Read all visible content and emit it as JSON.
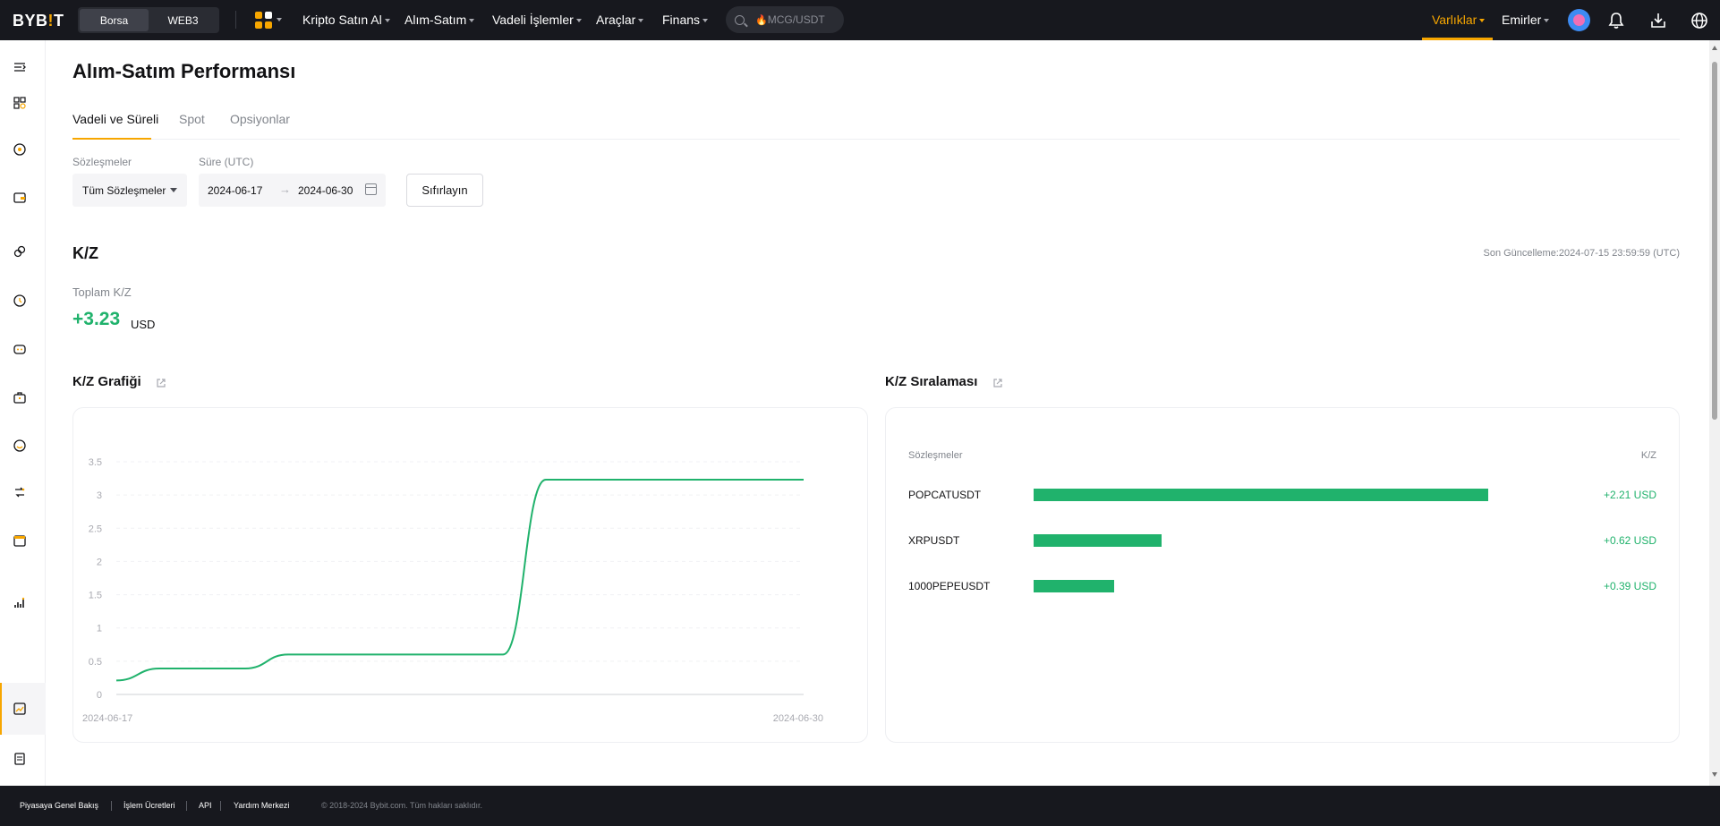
{
  "brand": {
    "logo_main": "BYB",
    "logo_i": "!",
    "logo_end": "T"
  },
  "top_nav": {
    "segment": {
      "left": "Borsa",
      "right": "WEB3",
      "active": "Borsa"
    },
    "menu": [
      {
        "label": "Kripto Satın Al"
      },
      {
        "label": "Alım-Satım"
      },
      {
        "label": "Vadeli İşlemler"
      },
      {
        "label": "Araçlar"
      },
      {
        "label": "Finans"
      }
    ],
    "search": {
      "placeholder": "MCG/USDT",
      "flame": "🔥"
    },
    "right": {
      "assets": "Varlıklar",
      "orders": "Emirler"
    }
  },
  "page": {
    "title": "Alım-Satım Performansı",
    "tabs": [
      {
        "label": "Vadeli ve Süreli",
        "active": true
      },
      {
        "label": "Spot",
        "active": false
      },
      {
        "label": "Opsiyonlar",
        "active": false
      }
    ],
    "filters": {
      "contracts_label": "Sözleşmeler",
      "contracts_value": "Tüm Sözleşmeler",
      "duration_label": "Süre (UTC)",
      "date_from": "2024-06-17",
      "date_arrow": "→",
      "date_to": "2024-06-30",
      "reset_label": "Sıfırlayın"
    },
    "pnl": {
      "title": "K/Z",
      "last_update": "Son Güncelleme:2024-07-15 23:59:59 (UTC)",
      "total_label": "Toplam K/Z",
      "total_value": "+3.23",
      "total_unit": "USD"
    },
    "chart_card": {
      "title": "K/Z Grafiği"
    },
    "ranking_card": {
      "title": "K/Z Sıralaması",
      "col_contract": "Sözleşmeler",
      "col_pnl": "K/Z",
      "rows": [
        {
          "symbol": "POPCATUSDT",
          "pnl": "+2.21 USD",
          "value": 2.21
        },
        {
          "symbol": "XRPUSDT",
          "pnl": "+0.62 USD",
          "value": 0.62
        },
        {
          "symbol": "1000PEPEUSDT",
          "pnl": "+0.39 USD",
          "value": 0.39
        }
      ]
    }
  },
  "chart_data": {
    "type": "line",
    "title": "K/Z Grafiği",
    "x_start_label": "2024-06-17",
    "x_end_label": "2024-06-30",
    "y_ticks": [
      "0",
      "0.5",
      "1",
      "1.5",
      "2",
      "2.5",
      "3",
      "3.5"
    ],
    "ylim": [
      0,
      3.5
    ],
    "grid": true,
    "color": "#20b26c",
    "series": [
      {
        "values": [
          0.21,
          0.39,
          0.39,
          0.39,
          0.6,
          0.6,
          0.6,
          0.6,
          0.6,
          0.6,
          3.23,
          3.23,
          3.23,
          3.23,
          3.23,
          3.23,
          3.23
        ]
      }
    ]
  },
  "footer": {
    "links": [
      "Piyasaya Genel Bakış",
      "İşlem Ücretleri",
      "API",
      "Yardım Merkezi"
    ],
    "copyright": "© 2018-2024 Bybit.com. Tüm hakları saklıdır."
  },
  "colors": {
    "accent": "#f7a600",
    "profit": "#20b26c",
    "nav_bg": "#17181e"
  }
}
